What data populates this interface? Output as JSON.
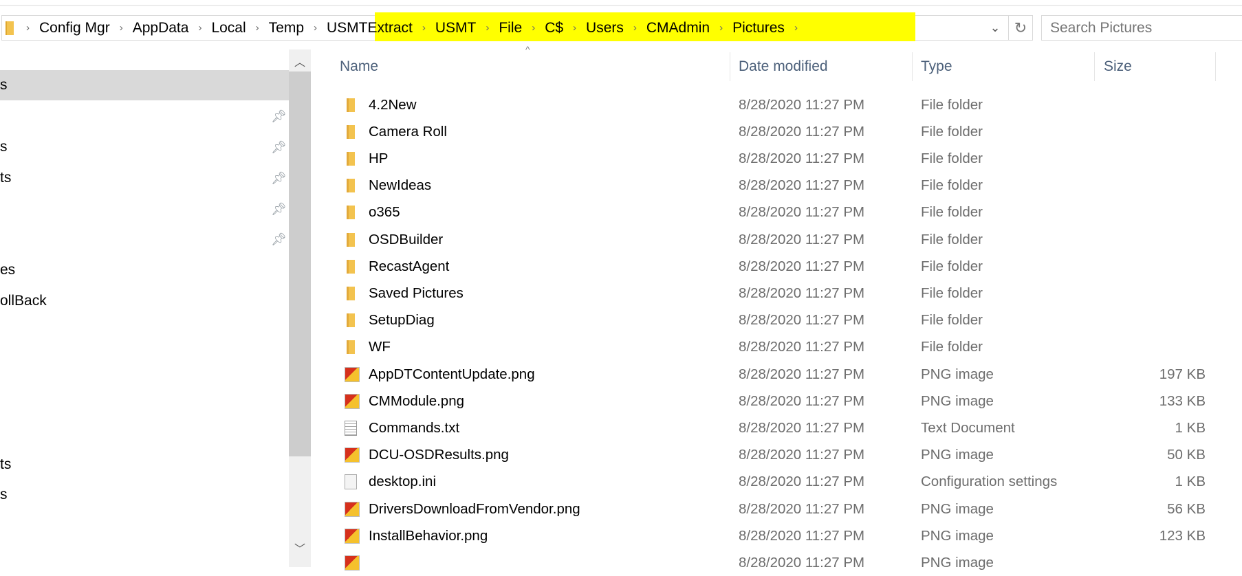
{
  "address_bar": {
    "crumbs": [
      "Config Mgr",
      "AppData",
      "Local",
      "Temp",
      "USMTExtract",
      "USMT",
      "File",
      "C$",
      "Users",
      "CMAdmin",
      "Pictures"
    ],
    "highlight_color": "#ffff00"
  },
  "search": {
    "placeholder": "Search Pictures"
  },
  "nav_pane": {
    "items": [
      {
        "label": "s",
        "selected": true,
        "pinned": false
      },
      {
        "label": "",
        "pinned": true
      },
      {
        "label": "s",
        "pinned": true
      },
      {
        "label": "ts",
        "pinned": true
      },
      {
        "label": "",
        "pinned": true
      },
      {
        "label": "",
        "pinned": true
      },
      {
        "label": "es",
        "pinned": false
      },
      {
        "label": "ollBack",
        "pinned": false
      },
      {
        "label": "ts",
        "pinned": false
      },
      {
        "label": "s",
        "pinned": false
      }
    ]
  },
  "columns": {
    "name": "Name",
    "date": "Date modified",
    "type": "Type",
    "size": "Size"
  },
  "files": [
    {
      "name": "4.2New",
      "date": "8/28/2020 11:27 PM",
      "type": "File folder",
      "size": "",
      "icon": "folder"
    },
    {
      "name": "Camera Roll",
      "date": "8/28/2020 11:27 PM",
      "type": "File folder",
      "size": "",
      "icon": "folder"
    },
    {
      "name": "HP",
      "date": "8/28/2020 11:27 PM",
      "type": "File folder",
      "size": "",
      "icon": "folder"
    },
    {
      "name": "NewIdeas",
      "date": "8/28/2020 11:27 PM",
      "type": "File folder",
      "size": "",
      "icon": "folder"
    },
    {
      "name": "o365",
      "date": "8/28/2020 11:27 PM",
      "type": "File folder",
      "size": "",
      "icon": "folder"
    },
    {
      "name": "OSDBuilder",
      "date": "8/28/2020 11:27 PM",
      "type": "File folder",
      "size": "",
      "icon": "folder"
    },
    {
      "name": "RecastAgent",
      "date": "8/28/2020 11:27 PM",
      "type": "File folder",
      "size": "",
      "icon": "folder"
    },
    {
      "name": "Saved Pictures",
      "date": "8/28/2020 11:27 PM",
      "type": "File folder",
      "size": "",
      "icon": "folder"
    },
    {
      "name": "SetupDiag",
      "date": "8/28/2020 11:27 PM",
      "type": "File folder",
      "size": "",
      "icon": "folder"
    },
    {
      "name": "WF",
      "date": "8/28/2020 11:27 PM",
      "type": "File folder",
      "size": "",
      "icon": "folder"
    },
    {
      "name": "AppDTContentUpdate.png",
      "date": "8/28/2020 11:27 PM",
      "type": "PNG image",
      "size": "197 KB",
      "icon": "png"
    },
    {
      "name": "CMModule.png",
      "date": "8/28/2020 11:27 PM",
      "type": "PNG image",
      "size": "133 KB",
      "icon": "png"
    },
    {
      "name": "Commands.txt",
      "date": "8/28/2020 11:27 PM",
      "type": "Text Document",
      "size": "1 KB",
      "icon": "txt"
    },
    {
      "name": "DCU-OSDResults.png",
      "date": "8/28/2020 11:27 PM",
      "type": "PNG image",
      "size": "50 KB",
      "icon": "png"
    },
    {
      "name": "desktop.ini",
      "date": "8/28/2020 11:27 PM",
      "type": "Configuration settings",
      "size": "1 KB",
      "icon": "ini"
    },
    {
      "name": "DriversDownloadFromVendor.png",
      "date": "8/28/2020 11:27 PM",
      "type": "PNG image",
      "size": "56 KB",
      "icon": "png"
    },
    {
      "name": "InstallBehavior.png",
      "date": "8/28/2020 11:27 PM",
      "type": "PNG image",
      "size": "123 KB",
      "icon": "png"
    },
    {
      "name": "",
      "date": "8/28/2020 11:27 PM",
      "type": "PNG image",
      "size": "",
      "icon": "png"
    }
  ]
}
